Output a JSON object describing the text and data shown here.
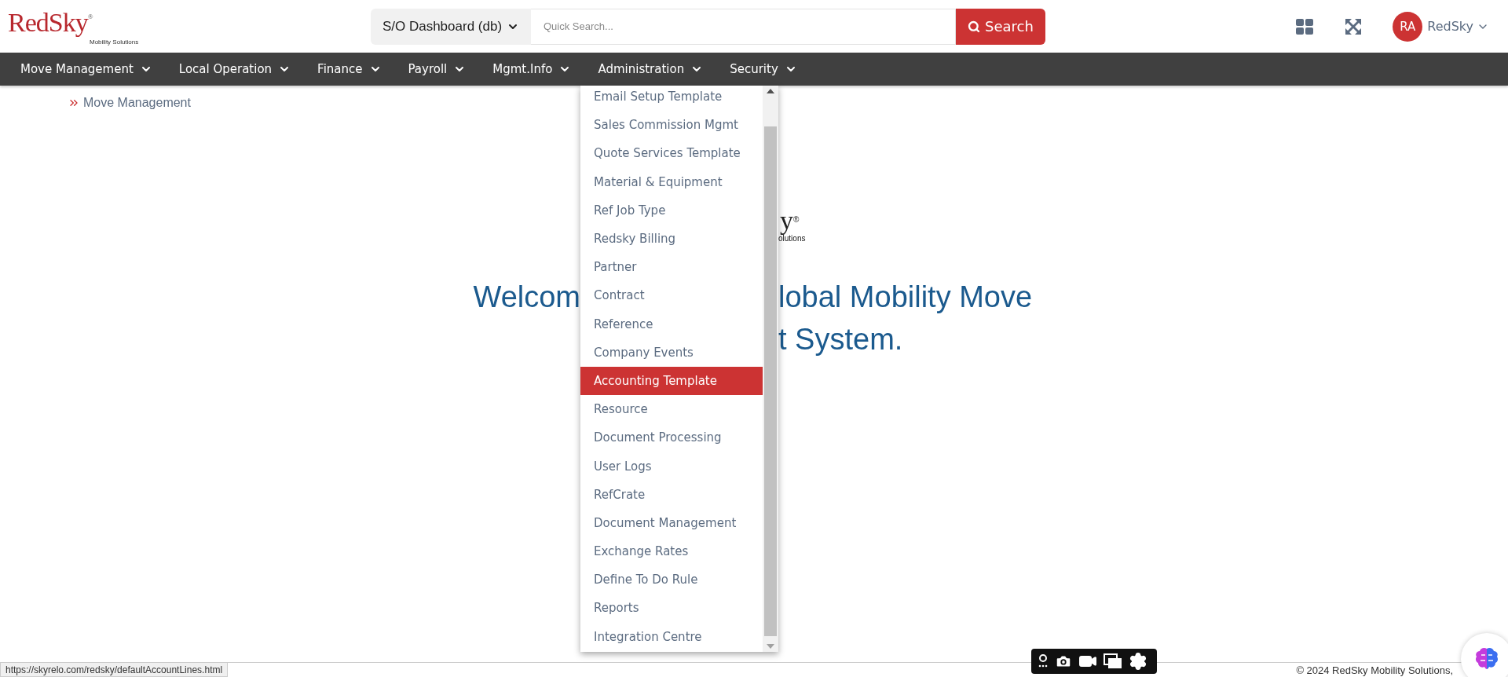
{
  "header": {
    "logo": {
      "name": "RedSky",
      "mark": "®",
      "tagline": "Mobility Solutions"
    },
    "dashboard_select": {
      "value": "S/O Dashboard (db)"
    },
    "search": {
      "placeholder": "Quick Search...",
      "button": "Search"
    },
    "user": {
      "initials": "RA",
      "name": "RedSky"
    }
  },
  "nav": [
    {
      "label": "Move Management"
    },
    {
      "label": "Local Operation"
    },
    {
      "label": "Finance"
    },
    {
      "label": "Payroll"
    },
    {
      "label": "Mgmt.Info"
    },
    {
      "label": "Administration"
    },
    {
      "label": "Security"
    }
  ],
  "admin_menu": {
    "items": [
      {
        "label": "Email Setup Template",
        "selected": false
      },
      {
        "label": "Sales Commission Mgmt",
        "selected": false
      },
      {
        "label": "Quote Services Template",
        "selected": false
      },
      {
        "label": "Material & Equipment",
        "selected": false
      },
      {
        "label": "Ref Job Type",
        "selected": false
      },
      {
        "label": "Redsky Billing",
        "selected": false
      },
      {
        "label": "Partner",
        "selected": false
      },
      {
        "label": "Contract",
        "selected": false
      },
      {
        "label": "Reference",
        "selected": false
      },
      {
        "label": "Company Events",
        "selected": false
      },
      {
        "label": "Accounting Template",
        "selected": true
      },
      {
        "label": "Resource",
        "selected": false
      },
      {
        "label": "Document Processing",
        "selected": false
      },
      {
        "label": "User Logs",
        "selected": false
      },
      {
        "label": "RefCrate",
        "selected": false
      },
      {
        "label": "Document Management",
        "selected": false
      },
      {
        "label": "Exchange Rates",
        "selected": false
      },
      {
        "label": "Define To Do Rule",
        "selected": false
      },
      {
        "label": "Reports",
        "selected": false
      },
      {
        "label": "Integration Centre",
        "selected": false
      }
    ]
  },
  "breadcrumb": {
    "label": "Move Management"
  },
  "welcome": {
    "logo_fragment": "y",
    "logo_mark": "®",
    "logo_tagline_fragment": "olutions",
    "line1_left": "Welcom",
    "line1_right": "lobal Mobility Move",
    "line2_right": "t System."
  },
  "status_url": "https://skyrelo.com/redsky/defaultAccountLines.html",
  "footer": "© 2024 RedSky Mobility Solutions,"
}
